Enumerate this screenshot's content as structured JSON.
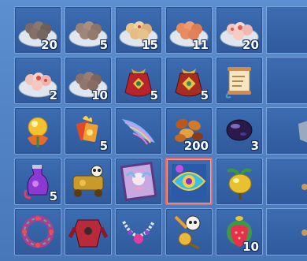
{
  "inventory": {
    "slots": [
      {
        "item": "dumplings-plate-brown-icon",
        "count": "20"
      },
      {
        "item": "dumplings-plate-brown-icon",
        "count": "5"
      },
      {
        "item": "dumplings-plate-gold-icon",
        "count": "15"
      },
      {
        "item": "dumplings-plate-orange-icon",
        "count": "11"
      },
      {
        "item": "dumplings-plate-flower-icon",
        "count": "20"
      },
      {
        "item": "dumplings-plate-flower-icon",
        "count": "2"
      },
      {
        "item": "dumplings-plate-brown-icon",
        "count": "10"
      },
      {
        "item": "lucky-pouch-red-icon",
        "count": "5"
      },
      {
        "item": "lucky-pouch-gold-icon",
        "count": "5"
      },
      {
        "item": "scroll-icon",
        "count": ""
      },
      {
        "item": "golden-flower-orb-icon",
        "count": ""
      },
      {
        "item": "flame-cards-icon",
        "count": "5"
      },
      {
        "item": "feather-plume-icon",
        "count": ""
      },
      {
        "item": "beans-icon",
        "count": "200"
      },
      {
        "item": "dark-orb-icon",
        "count": "3"
      },
      {
        "item": "purple-potion-vase-icon",
        "count": "5"
      },
      {
        "item": "golden-treasure-cart-icon",
        "count": ""
      },
      {
        "item": "fairy-portrait-frame-icon",
        "count": ""
      },
      {
        "item": "eye-medallion-icon",
        "count": ""
      },
      {
        "item": "golden-fruit-icon",
        "count": ""
      },
      {
        "item": "spiked-wreath-icon",
        "count": ""
      },
      {
        "item": "red-armor-icon",
        "count": ""
      },
      {
        "item": "pearl-necklace-icon",
        "count": ""
      },
      {
        "item": "panda-scepter-icon",
        "count": ""
      },
      {
        "item": "strawberry-gem-icon",
        "count": "10"
      }
    ],
    "selected_index": 18,
    "colors": {
      "slot": "#3d6cb1",
      "slot_border": "#7aa5dd",
      "selected_border": "#e46d6d",
      "background": "#5b8fd0"
    }
  }
}
